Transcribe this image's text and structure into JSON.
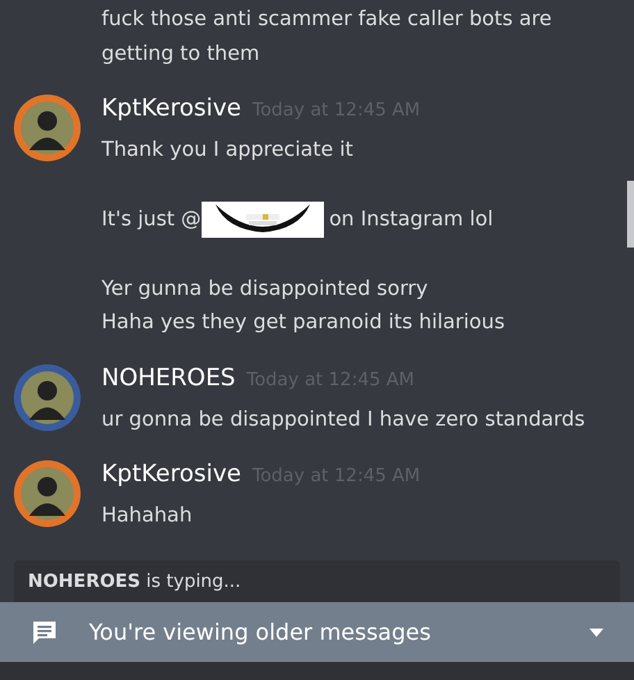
{
  "messages": [
    {
      "kind": "continuation",
      "lines": [
        {
          "kind": "text",
          "text": "fuck those anti scammer fake caller bots are getting to them"
        }
      ]
    },
    {
      "kind": "group",
      "author": "KptKerosive",
      "time": "Today at 12:45 AM",
      "color": "#e0742a",
      "lines": [
        {
          "kind": "text",
          "text": "Thank you I appreciate it"
        },
        {
          "kind": "gap"
        },
        {
          "kind": "mention",
          "before": "It's just @",
          "after": "on Instagram lol"
        },
        {
          "kind": "gap"
        },
        {
          "kind": "text",
          "text": "Yer gunna be disappointed sorry"
        },
        {
          "kind": "text",
          "text": "Haha yes they get paranoid its hilarious"
        }
      ]
    },
    {
      "kind": "group",
      "author": "NOHEROES",
      "time": "Today at 12:45 AM",
      "color": "#3b5c9c",
      "lines": [
        {
          "kind": "text",
          "text": "ur gonna be disappointed I have zero standards"
        }
      ]
    },
    {
      "kind": "group",
      "author": "KptKerosive",
      "time": "Today at 12:45 AM",
      "color": "#e0742a",
      "lines": [
        {
          "kind": "text",
          "text": "Hahahah"
        }
      ]
    }
  ],
  "typing": "**NOHEROES** is typing...",
  "banner": {
    "text": "You're viewing older messages"
  }
}
